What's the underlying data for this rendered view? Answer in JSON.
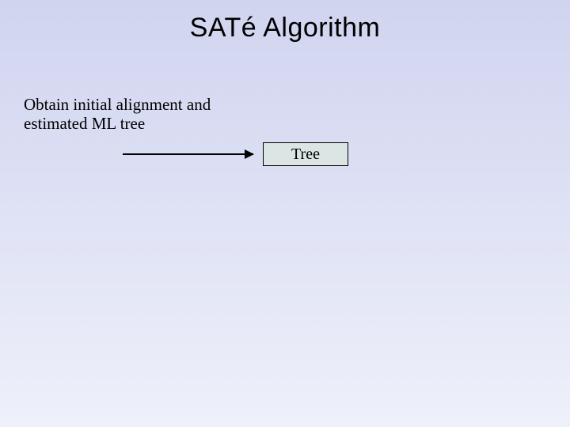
{
  "title": "SATé Algorithm",
  "step": {
    "description": "Obtain initial alignment and estimated ML tree"
  },
  "box": {
    "label": "Tree"
  }
}
